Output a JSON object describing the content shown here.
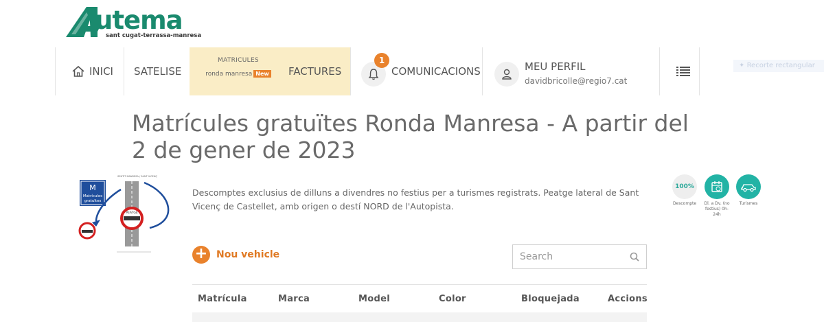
{
  "brand": {
    "name": "Autema",
    "word": "utema",
    "tagline": "sant cugat-terrassa-manresa",
    "color": "#1a8a6e"
  },
  "nav": {
    "home": "INICI",
    "satelise": "SATELISE",
    "matricules_top": "MATRICULES",
    "matricules_bottom": "ronda manresa",
    "new_badge": "New",
    "factures": "FACTURES",
    "notifications_count": "1",
    "communications": "COMUNICACIONS",
    "profile_title": "MEU PERFIL",
    "profile_email": "davidbricolle@regio7.cat"
  },
  "ghost_text": "Recorte rectangular",
  "page": {
    "title": "Matrícules gratuïtes Ronda Manresa - A partir del 2 de gener de 2023",
    "description": "Descomptes exclusius de dilluns a divendres no festius per a turismes registrats. Peatge lateral de Sant Vicenç de Castellet, amb origen o destí NORD de l'Autopista."
  },
  "diagram": {
    "sign_letter": "M",
    "sign_line1": "Matrícules",
    "sign_line2": "gratuïtes",
    "toll_label": "PEATGE",
    "top_text": "SENTIT MANRESA / SANT VICENÇ"
  },
  "features": [
    {
      "value": "100%",
      "label": "Descompte"
    },
    {
      "label": "Dl. a Dv. (no festius) 0h-24h"
    },
    {
      "label": "Turismes"
    }
  ],
  "actions": {
    "add_vehicle": "Nou vehicle",
    "search_placeholder": "Search"
  },
  "table": {
    "columns": [
      "Matrícula",
      "Marca",
      "Model",
      "Color",
      "Bloquejada",
      "Accions"
    ]
  },
  "colors": {
    "accent": "#e9822c",
    "teal": "#22b3a5",
    "highlight": "#faedc6"
  }
}
